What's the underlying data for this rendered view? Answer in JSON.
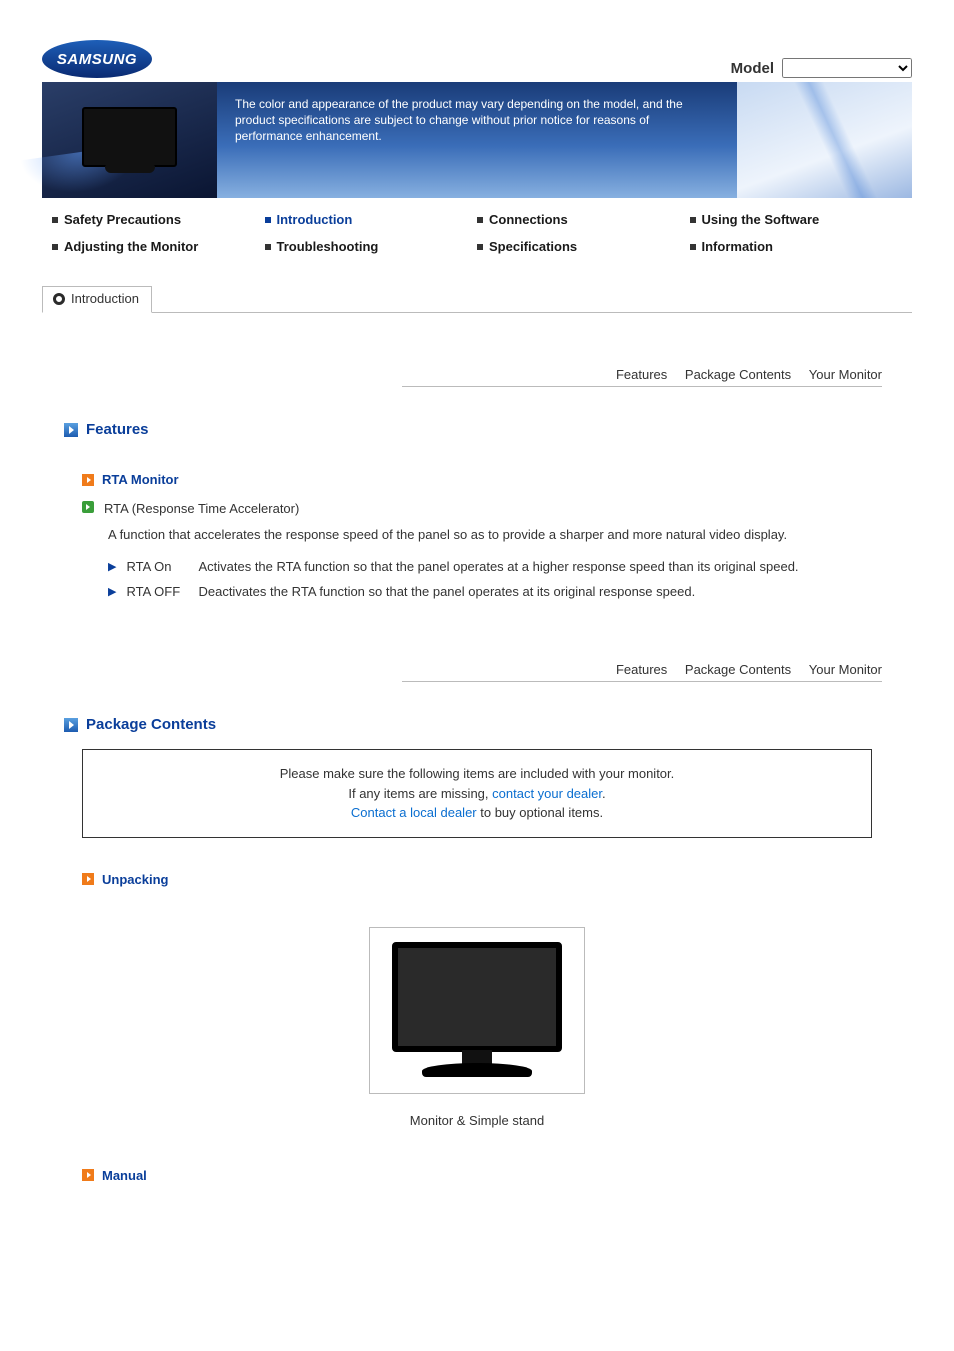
{
  "logo_text": "SAMSUNG",
  "model_label": "Model",
  "banner_notice": "The color and appearance of the product may vary depending on the model, and the product specifications are subject to change without prior notice for reasons of performance enhancement.",
  "nav": [
    "Safety Precautions",
    "Introduction",
    "Connections",
    "Using the Software",
    "Adjusting the Monitor",
    "Troubleshooting",
    "Specifications",
    "Information"
  ],
  "nav_active_index": 1,
  "section_tab": "Introduction",
  "subnav": [
    "Features",
    "Package Contents",
    "Your Monitor"
  ],
  "features": {
    "heading": "Features",
    "rta_title": "RTA Monitor",
    "rta_expansion": "RTA (Response Time Accelerator)",
    "rta_desc": "A function that accelerates the response speed of the panel so as to provide a sharper and more natural video display.",
    "items": [
      {
        "label": "RTA On",
        "text": "Activates the RTA function so that the panel operates at a higher response speed than its original speed."
      },
      {
        "label": "RTA OFF",
        "text": "Deactivates the RTA function so that the panel operates at its original response speed."
      }
    ]
  },
  "package": {
    "heading": "Package Contents",
    "note_line1": "Please make sure the following items are included with your monitor.",
    "note_line2_prefix": "If any items are missing, ",
    "note_line2_link": "contact your dealer",
    "note_line2_suffix": ".",
    "note_line3_link": "Contact a local dealer",
    "note_line3_suffix": " to buy optional items.",
    "unpacking_heading": "Unpacking",
    "figure_caption": "Monitor & Simple stand",
    "manual_heading": "Manual"
  }
}
